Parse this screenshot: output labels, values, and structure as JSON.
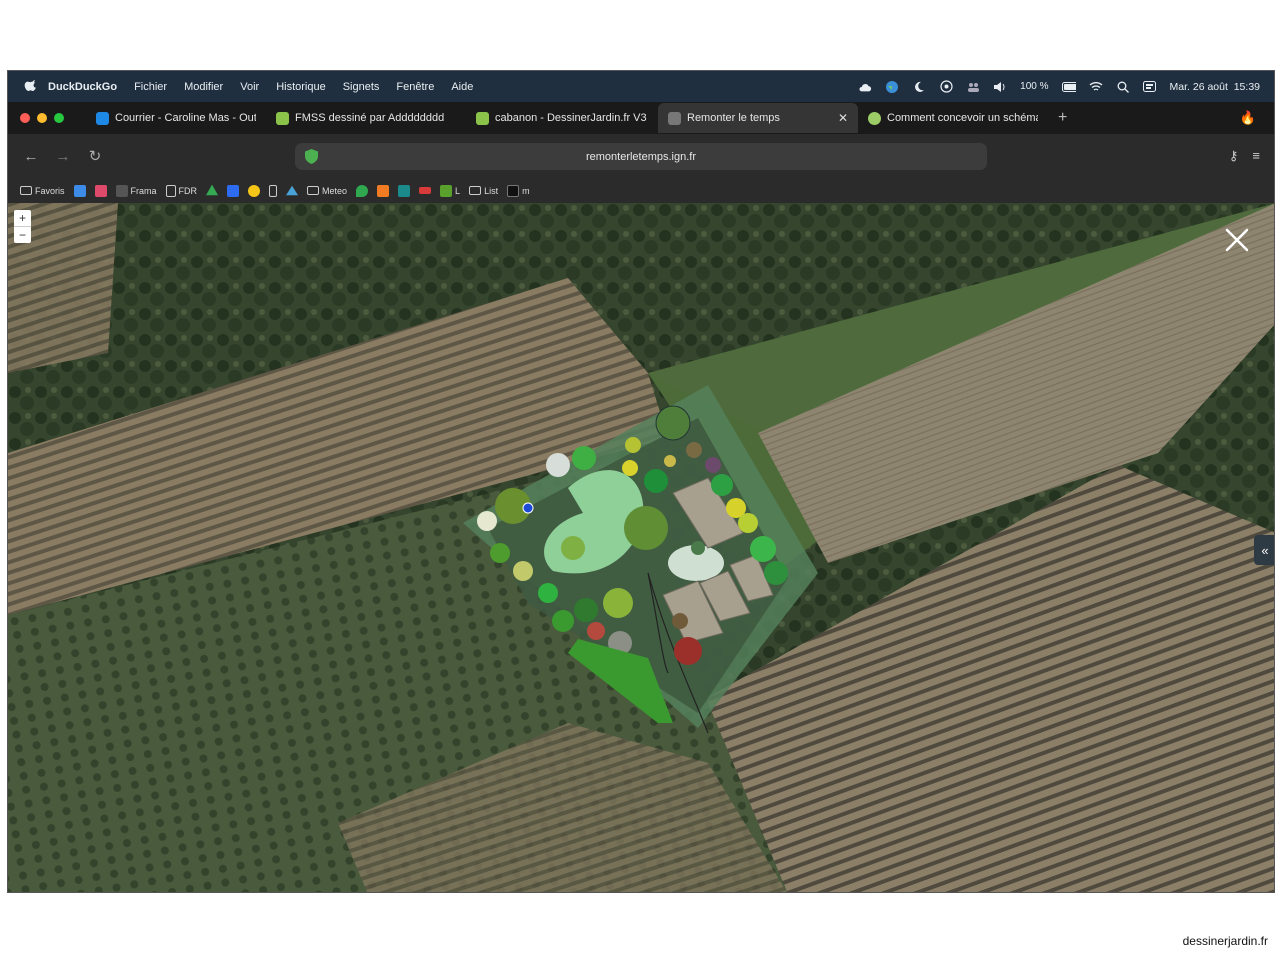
{
  "menubar": {
    "app": "DuckDuckGo",
    "items": [
      "Fichier",
      "Modifier",
      "Voir",
      "Historique",
      "Signets",
      "Fenêtre",
      "Aide"
    ],
    "battery": "100 %",
    "datetime": "Mar. 26 août  15:39"
  },
  "tabs": [
    {
      "label": "Courrier - Caroline Mas - Outlo",
      "color": "#1e88e5"
    },
    {
      "label": "FMSS dessiné par Adddddddd",
      "color": "#8bc34a"
    },
    {
      "label": "cabanon - DessinerJardin.fr V3",
      "color": "#8bc34a"
    },
    {
      "label": "Remonter le temps",
      "color": "#777777",
      "active": true
    },
    {
      "label": "Comment concevoir un schéma",
      "color": "#9ccc65"
    }
  ],
  "address": {
    "url": "remonterletemps.ign.fr"
  },
  "bookmarks": [
    {
      "label": "Favoris",
      "icon": "folder-icon"
    },
    {
      "label": "",
      "icon": "mail-icon",
      "color": "#3c8ce7"
    },
    {
      "label": "",
      "icon": "app-icon",
      "color": "#e04a6a"
    },
    {
      "label": "Frama",
      "icon": "frama-icon",
      "color": "#555555"
    },
    {
      "label": "FDR",
      "icon": "page-icon"
    },
    {
      "label": "",
      "icon": "drive-icon",
      "color": "#34a853"
    },
    {
      "label": "",
      "icon": "dropbox-icon",
      "color": "#2d6cf0"
    },
    {
      "label": "",
      "icon": "bulb-icon",
      "color": "#f5c518"
    },
    {
      "label": "",
      "icon": "phone-icon"
    },
    {
      "label": "",
      "icon": "mountain-icon",
      "color": "#4aa3d8"
    },
    {
      "label": "Meteo",
      "icon": "folder-icon"
    },
    {
      "label": "",
      "icon": "maps-icon",
      "color": "#2fa84f"
    },
    {
      "label": "",
      "icon": "orange-icon",
      "color": "#f07b22"
    },
    {
      "label": "",
      "icon": "v-icon",
      "color": "#1a8a8a"
    },
    {
      "label": "",
      "icon": "red-icon",
      "color": "#d93a3a"
    },
    {
      "label": "L",
      "icon": "plant-icon",
      "color": "#5aa02c"
    },
    {
      "label": "List",
      "icon": "folder-icon"
    },
    {
      "label": "m",
      "icon": "tt-icon",
      "color": "#111111"
    }
  ],
  "map": {
    "zoom_in": "+",
    "zoom_out": "−",
    "side_toggle": "«"
  },
  "footer": "dessinerjardin.fr"
}
